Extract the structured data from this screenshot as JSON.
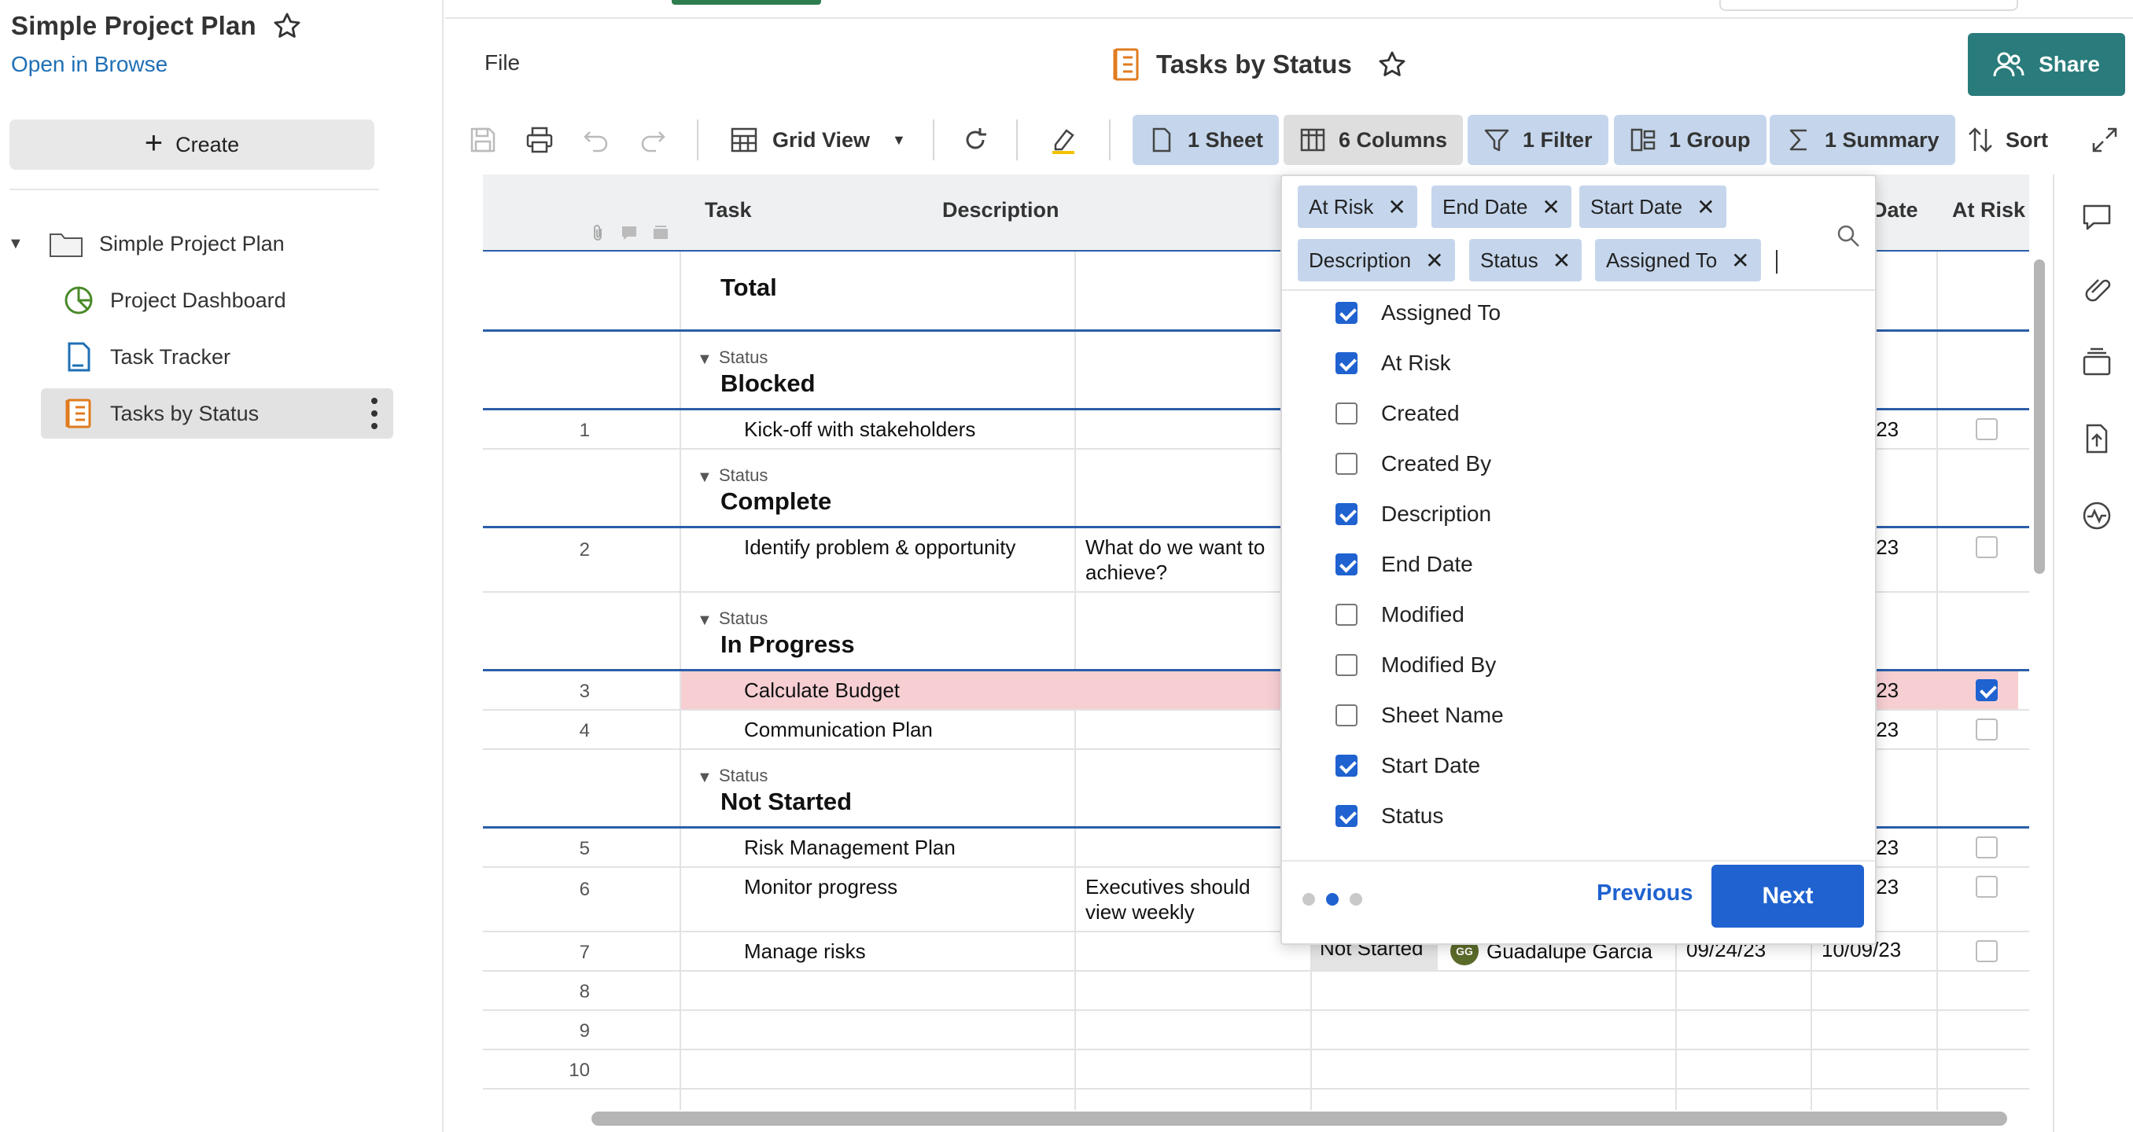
{
  "sidebar": {
    "workspace_title": "Simple Project Plan",
    "open_in_browse": "Open in Browse",
    "create_label": "Create",
    "tree": {
      "root": "Simple Project Plan",
      "items": [
        {
          "label": "Project Dashboard",
          "icon": "dashboard-icon"
        },
        {
          "label": "Task Tracker",
          "icon": "sheet-icon"
        },
        {
          "label": "Tasks by Status",
          "icon": "report-icon"
        }
      ]
    }
  },
  "header": {
    "file_menu": "File",
    "sheet_title": "Tasks by Status",
    "share_label": "Share"
  },
  "toolbar": {
    "grid_view_label": "Grid View",
    "chips": {
      "sheet": "1 Sheet",
      "columns": "6 Columns",
      "filter": "1 Filter",
      "group": "1 Group",
      "summary": "1 Summary"
    },
    "sort_label": "Sort"
  },
  "grid": {
    "columns": {
      "task": "Task",
      "description": "Description",
      "date_fragment": "Date",
      "at_risk": "At Risk"
    },
    "total_label": "Total",
    "status_label": "Status",
    "groups": {
      "blocked": "Blocked",
      "complete": "Complete",
      "in_progress": "In Progress",
      "not_started": "Not Started"
    },
    "rows": [
      {
        "num": "1",
        "task": "Kick-off with stakeholders",
        "desc1": "",
        "desc2": "",
        "date_frag": "/23",
        "at_risk": false
      },
      {
        "num": "2",
        "task": "Identify problem & opportunity",
        "desc1": "What do we want to",
        "desc2": "achieve?",
        "date_frag": "/23",
        "at_risk": false
      },
      {
        "num": "3",
        "task": "Calculate Budget",
        "desc1": "",
        "desc2": "",
        "date_frag": "/23",
        "at_risk": true
      },
      {
        "num": "4",
        "task": "Communication Plan",
        "desc1": "",
        "desc2": "",
        "date_frag": "/23",
        "at_risk": false
      },
      {
        "num": "5",
        "task": "Risk Management Plan",
        "desc1": "",
        "desc2": "",
        "date_frag": "/23",
        "at_risk": false
      },
      {
        "num": "6",
        "task": "Monitor progress",
        "desc1": "Executives should",
        "desc2": "view weekly",
        "date_frag": "/23",
        "at_risk": false
      },
      {
        "num": "7",
        "task": "Manage risks",
        "desc1": "",
        "desc2": "",
        "status": "Not Started",
        "assignee_initials": "GG",
        "assignee": "Guadalupe Garcia",
        "start_date": "09/24/23",
        "end_date": "10/09/23",
        "at_risk": false
      }
    ],
    "empty_rows": [
      "8",
      "9",
      "10"
    ]
  },
  "picker": {
    "tokens": [
      "At Risk",
      "End Date",
      "Start Date",
      "Description",
      "Status",
      "Assigned To"
    ],
    "options": [
      {
        "label": "Assigned To",
        "checked": true
      },
      {
        "label": "At Risk",
        "checked": true
      },
      {
        "label": "Created",
        "checked": false
      },
      {
        "label": "Created By",
        "checked": false
      },
      {
        "label": "Description",
        "checked": true
      },
      {
        "label": "End Date",
        "checked": true
      },
      {
        "label": "Modified",
        "checked": false
      },
      {
        "label": "Modified By",
        "checked": false
      },
      {
        "label": "Sheet Name",
        "checked": false
      },
      {
        "label": "Start Date",
        "checked": true
      },
      {
        "label": "Status",
        "checked": true
      }
    ],
    "previous_label": "Previous",
    "next_label": "Next",
    "step_total": 3,
    "step_current": 2
  },
  "colors": {
    "accent_blue": "#1f62d0",
    "share_teal": "#2a7b7b",
    "chip_blue": "#c5d6ec",
    "at_risk_row": "#f7cfd3",
    "group_line": "#2b5ea8"
  }
}
